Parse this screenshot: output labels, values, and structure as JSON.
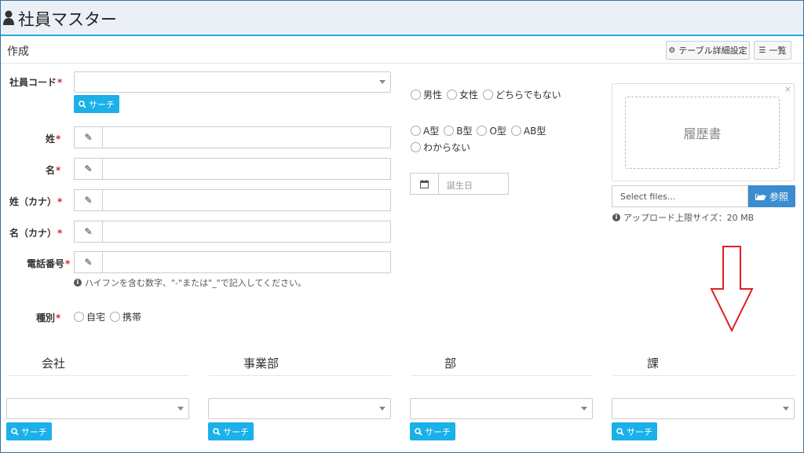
{
  "header": {
    "title": "社員マスター",
    "icon": "user-icon"
  },
  "form": {
    "section_title": "作成",
    "table_settings_label": "テーブル詳細設定",
    "list_label": "一覧",
    "employee_code_label": "社員コード",
    "search_label": "サーチ",
    "last_name_label": "姓",
    "first_name_label": "名",
    "last_name_kana_label": "姓（カナ）",
    "first_name_kana_label": "名（カナ）",
    "phone_label": "電話番号",
    "phone_help": "ハイフンを含む数字、\"-\"または\"_\"で記入してください。",
    "type_label": "種別",
    "type_options": [
      "自宅",
      "携帯"
    ],
    "required_mark": "*"
  },
  "gender": {
    "options": [
      "男性",
      "女性",
      "どちらでもない"
    ]
  },
  "blood": {
    "options": [
      "A型",
      "B型",
      "O型",
      "AB型",
      "わからない"
    ]
  },
  "birthday": {
    "placeholder": "誕生日"
  },
  "upload": {
    "preview_text": "履歴書",
    "close": "×",
    "file_placeholder": "Select files...",
    "browse_label": "参照",
    "limit_text": "アップロード上限サイズ：20 MB"
  },
  "org": {
    "columns": [
      "会社",
      "事業部",
      "部",
      "課"
    ],
    "search_label": "サーチ"
  },
  "colors": {
    "accent": "#1ab0e8",
    "browse": "#3b8dd0",
    "required": "#d9252a",
    "arrow": "#e02020"
  }
}
